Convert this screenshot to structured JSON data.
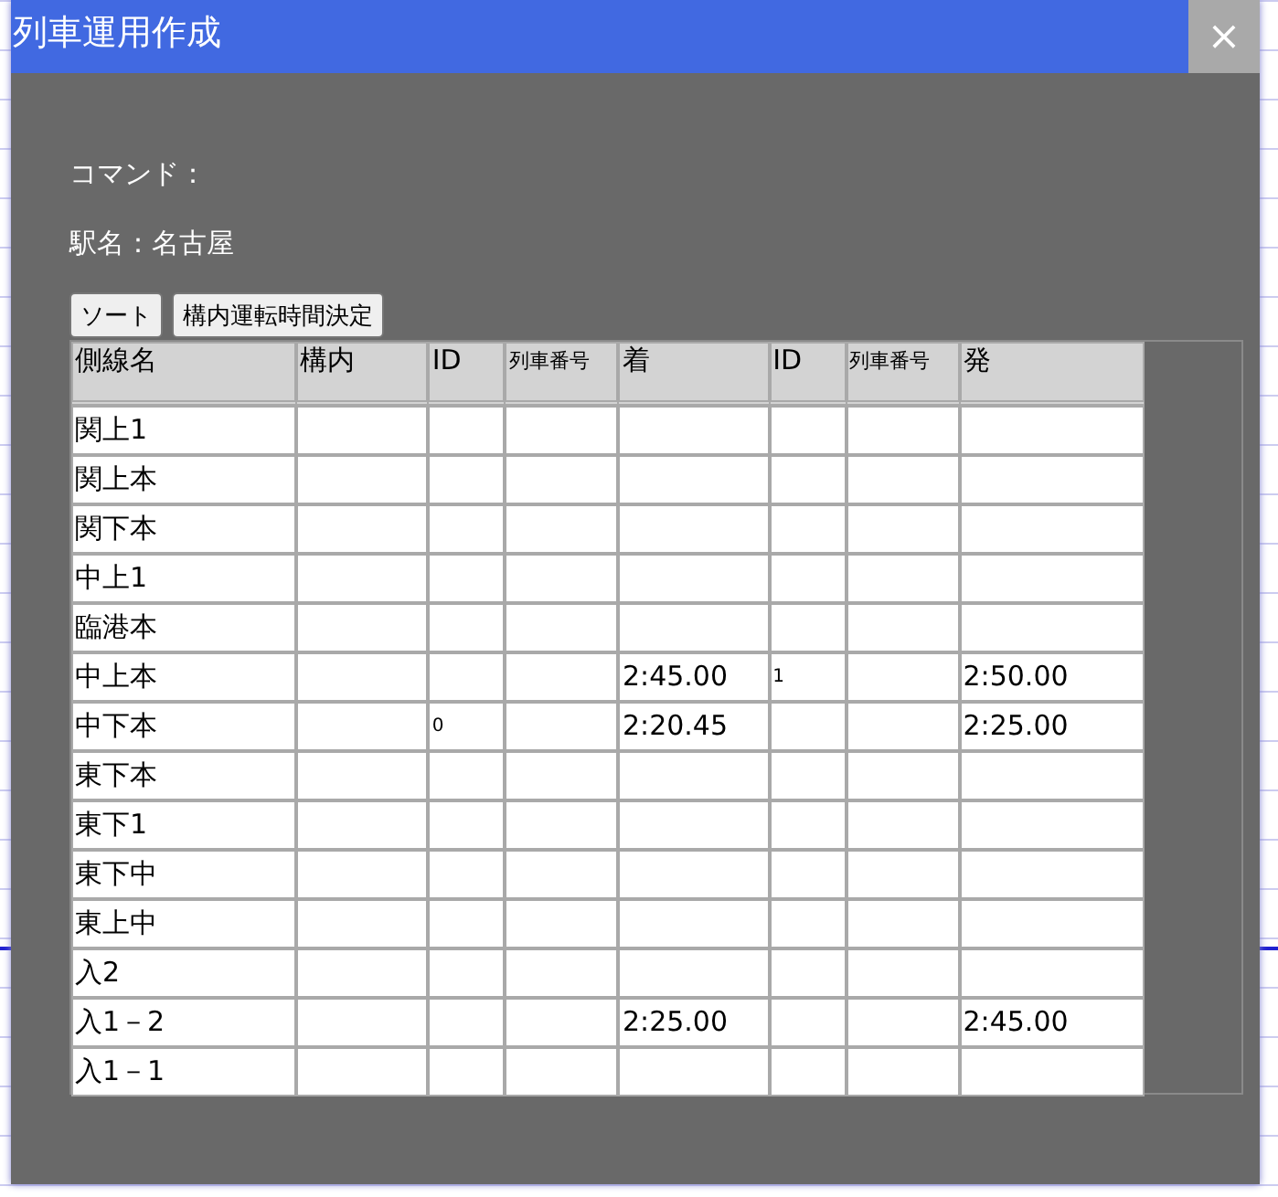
{
  "window": {
    "title": "列車運用作成",
    "close": "×"
  },
  "command_label": "コマンド：",
  "station_label": "駅名：名古屋",
  "buttons": [
    "ソート",
    "構内運転時間決定"
  ],
  "table": {
    "columns": [
      {
        "label": "側線名",
        "kind": "name"
      },
      {
        "label": "構内",
        "kind": "text"
      },
      {
        "label": "ID",
        "kind": "id"
      },
      {
        "label": "列車番号",
        "kind": "number"
      },
      {
        "label": "着",
        "kind": "text"
      },
      {
        "label": "ID",
        "kind": "id"
      },
      {
        "label": "列車番号",
        "kind": "number"
      },
      {
        "label": "発",
        "kind": "text"
      }
    ],
    "rows": [
      {
        "track": "関上1"
      },
      {
        "track": "関上本"
      },
      {
        "track": "関下本"
      },
      {
        "track": "中上1"
      },
      {
        "track": "臨港本"
      },
      {
        "track": "中上本",
        "arrival": "2:45.00",
        "out_id": "1",
        "departure": "2:50.00"
      },
      {
        "track": "中下本",
        "in_id": "0",
        "arrival": "2:20.45",
        "departure": "2:25.00"
      },
      {
        "track": "東下本"
      },
      {
        "track": "東下1"
      },
      {
        "track": "東下中"
      },
      {
        "track": "東上中"
      },
      {
        "track": "入2"
      },
      {
        "track": "入1－2",
        "arrival": "2:25.00",
        "departure": "2:45.00"
      },
      {
        "track": "入1－1"
      }
    ]
  }
}
